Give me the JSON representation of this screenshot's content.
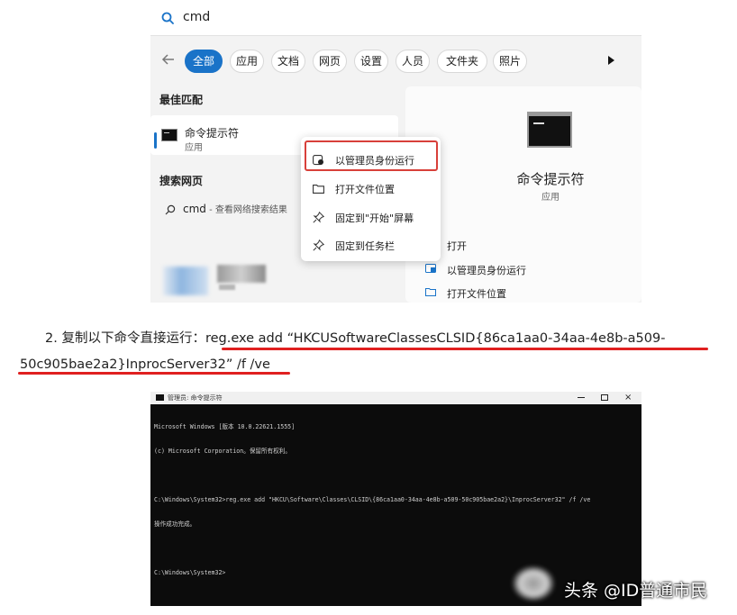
{
  "search": {
    "query": "cmd",
    "filters": [
      "全部",
      "应用",
      "文档",
      "网页",
      "设置",
      "人员",
      "文件夹",
      "照片"
    ],
    "best_match_title": "最佳匹配",
    "app_name": "命令提示符",
    "app_type": "应用",
    "web_section_title": "搜索网页",
    "web_query": "cmd",
    "web_hint": " - 查看网络搜索结果",
    "context_menu": [
      "以管理员身份运行",
      "打开文件位置",
      "固定到\"开始\"屏幕",
      "固定到任务栏"
    ],
    "preview_name": "命令提示符",
    "preview_type": "应用",
    "preview_actions": [
      "打开",
      "以管理员身份运行",
      "打开文件位置"
    ]
  },
  "instruction": {
    "prefix": "2. 复制以下命令直接运行：",
    "command_part1": "reg.exe add “HKCUSoftwareClassesCLSID{86ca1aa0-34aa-4e8b-a509-",
    "command_part2": "50c905bae2a2}InprocServer32” /f /ve"
  },
  "console": {
    "title": "管理员: 命令提示符",
    "close_glyph": "×",
    "lines": [
      "Microsoft Windows [版本 10.0.22621.1555]",
      "(c) Microsoft Corporation。保留所有权利。",
      "",
      "C:\\Windows\\System32>reg.exe add \"HKCU\\Software\\Classes\\CLSID\\{86ca1aa0-34aa-4e8b-a509-50c905bae2a2}\\InprocServer32\" /f /ve",
      "操作成功完成。",
      "",
      "C:\\Windows\\System32>"
    ]
  },
  "watermark": {
    "text": "头条 @ID普通市民"
  },
  "colors": {
    "accent": "#1a73c8",
    "highlight_red": "#d8403a",
    "underline_red": "#e02020",
    "console_bg": "#0c0c0c"
  }
}
